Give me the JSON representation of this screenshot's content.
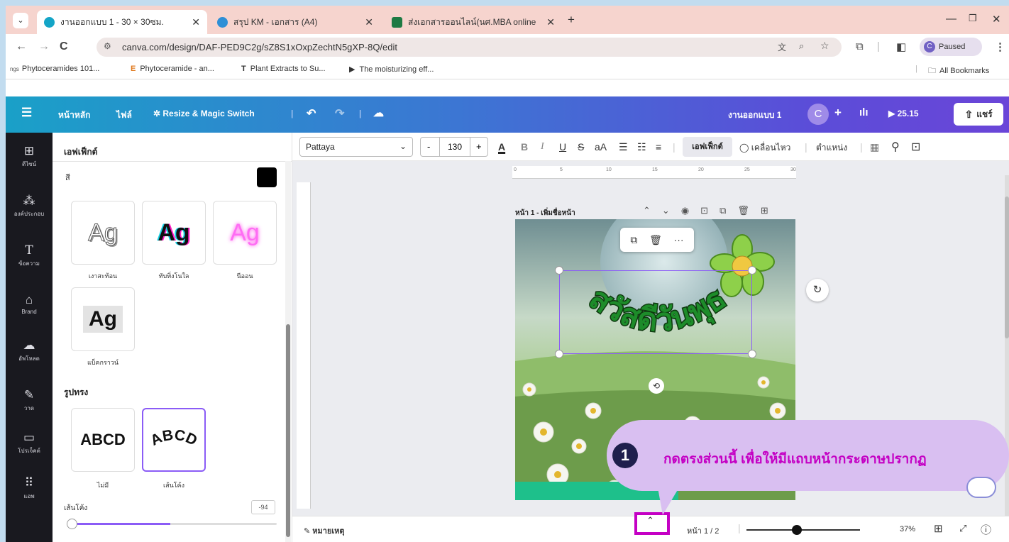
{
  "browser": {
    "tabs": [
      {
        "title": "งานออกแบบ 1 - 30 × 30ซม.",
        "active": true
      },
      {
        "title": "สรุป KM - เอกสาร (A4)",
        "active": false
      },
      {
        "title": "ส่งเอกสารออนไลน์(นศ.MBA online",
        "active": false
      }
    ],
    "new_tab": "+",
    "url": "canva.com/design/DAF-PED9C2g/sZ8S1xOxpZechtN5gXP-8Q/edit",
    "profile_letter": "C",
    "profile_status": "Paused",
    "bookmarks": [
      {
        "label": "Phytoceramides 101..."
      },
      {
        "label": "Phytoceramide - an..."
      },
      {
        "label": "Plant Extracts to Su..."
      },
      {
        "label": "The moisturizing eff..."
      }
    ],
    "all_bookmarks": "All Bookmarks"
  },
  "canva_header": {
    "home": "หน้าหลัก",
    "file": "ไฟล์",
    "resize": "Resize & Magic Switch",
    "design_name": "งานออกแบบ 1",
    "avatar": "C",
    "timer": "25.15",
    "share": "แชร์"
  },
  "rail": [
    {
      "label": "ดีไซน์",
      "icon": "layout-icon"
    },
    {
      "label": "องค์ประกอบ",
      "icon": "elements-icon"
    },
    {
      "label": "ข้อความ",
      "icon": "text-icon"
    },
    {
      "label": "Brand",
      "icon": "brand-icon"
    },
    {
      "label": "อัพโหลด",
      "icon": "upload-icon"
    },
    {
      "label": "วาด",
      "icon": "draw-icon"
    },
    {
      "label": "โปรเจ็คต์",
      "icon": "folder-icon"
    },
    {
      "label": "แอพ",
      "icon": "apps-icon"
    }
  ],
  "panel": {
    "title": "เอฟเฟ็กต์",
    "color_label": "สี",
    "effects": [
      {
        "sample": "Ag",
        "label": "เงาสะท้อน"
      },
      {
        "sample": "Ag",
        "label": "ทับทิ่งโนใล"
      },
      {
        "sample": "Ag",
        "label": "นีออน"
      },
      {
        "sample": "Ag",
        "label": "แบ็คกราวน์"
      }
    ],
    "shape_title": "รูปทรง",
    "shapes": [
      {
        "sample": "ABCD",
        "label": "ไม่มี"
      },
      {
        "sample": "ABCD",
        "label": "เส้นโค้ง"
      }
    ],
    "curve_label": "เส้นโค้ง",
    "curve_value": "-94",
    "curve_fraction": 0.0
  },
  "toolbar": {
    "font": "Pattaya",
    "minus": "-",
    "size": "130",
    "plus": "+",
    "effects": "เอฟเฟ็กต์",
    "animate": "เคลื่อนไหว",
    "position": "ตำแหน่ง"
  },
  "ruler_ticks": [
    "0",
    "5",
    "10",
    "15",
    "20",
    "25",
    "30"
  ],
  "page_label": "หน้า 1 - เพิ่มชื่อหน้า",
  "canvas_text": "สวัสดีวันพุธ",
  "footer": {
    "notes": "หมายเหตุ",
    "page_indicator": "หน้า 1 / 2",
    "zoom": "37%",
    "zoom_fraction": 0.37
  },
  "callout": {
    "number": "1",
    "text": "กดตรงส่วนนี้ เพื่อให้มีแถบหน้ากระดาษปรากฏ"
  },
  "colors": {
    "header_start": "#1aa0c8",
    "header_end": "#6a45d8",
    "highlight": "#c400c4",
    "callout_bg": "#d9bff1",
    "callout_text": "#c400c4",
    "selection": "#8b5cf6"
  }
}
